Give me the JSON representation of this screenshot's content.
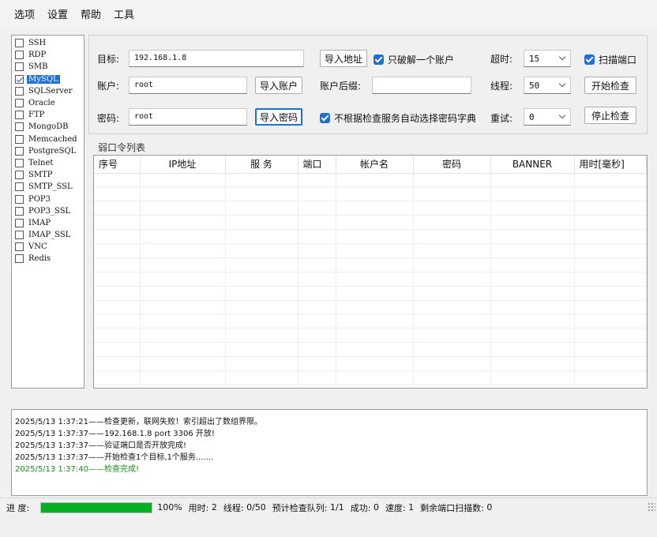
{
  "menu": [
    "选项",
    "设置",
    "帮助",
    "工具"
  ],
  "services": [
    {
      "name": "SSH",
      "checked": false
    },
    {
      "name": "RDP",
      "checked": false
    },
    {
      "name": "SMB",
      "checked": false
    },
    {
      "name": "MySQL",
      "checked": true,
      "selected": true
    },
    {
      "name": "SQLServer",
      "checked": false
    },
    {
      "name": "Oracle",
      "checked": false
    },
    {
      "name": "FTP",
      "checked": false
    },
    {
      "name": "MongoDB",
      "checked": false
    },
    {
      "name": "Memcached",
      "checked": false
    },
    {
      "name": "PostgreSQL",
      "checked": false
    },
    {
      "name": "Telnet",
      "checked": false
    },
    {
      "name": "SMTP",
      "checked": false
    },
    {
      "name": "SMTP_SSL",
      "checked": false
    },
    {
      "name": "POP3",
      "checked": false
    },
    {
      "name": "POP3_SSL",
      "checked": false
    },
    {
      "name": "IMAP",
      "checked": false
    },
    {
      "name": "IMAP_SSL",
      "checked": false
    },
    {
      "name": "VNC",
      "checked": false
    },
    {
      "name": "Redis",
      "checked": false
    }
  ],
  "form": {
    "target_label": "目标:",
    "target_value": "192.168.1.8",
    "import_addr": "导入地址",
    "only_crack_one": "只破解一个账户",
    "timeout_label": "超时:",
    "timeout_value": "15",
    "scan_port": "扫描端口",
    "account_label": "账户:",
    "account_value": "root",
    "import_account": "导入账户",
    "suffix_label": "账户后缀:",
    "suffix_value": "",
    "threads_label": "线程:",
    "threads_value": "50",
    "start_check": "开始检查",
    "password_label": "密码:",
    "password_value": "root",
    "import_password": "导入密码",
    "no_auto_dict": "不根据检查服务自动选择密码字典",
    "retry_label": "重试:",
    "retry_value": "0",
    "stop_check": "停止检查"
  },
  "weak_list": {
    "title": "弱口令列表",
    "columns": [
      "序号",
      "IP地址",
      "服 务",
      "端口",
      "帐户名",
      "密码",
      "BANNER",
      "用时[毫秒]"
    ]
  },
  "log": [
    {
      "text": "2025/5/13 1:37:21——检查更新，联网失败！索引超出了数组界限。",
      "status": "normal"
    },
    {
      "text": "2025/5/13 1:37:37——192.168.1.8 port 3306 开放!",
      "status": "normal"
    },
    {
      "text": "2025/5/13 1:37:37——验证端口是否开放完成!",
      "status": "normal"
    },
    {
      "text": "2025/5/13 1:37:37——开始检查1个目标,1个服务.......",
      "status": "normal"
    },
    {
      "text": "2025/5/13 1:37:40——检查完成!",
      "status": "ok"
    }
  ],
  "status": {
    "progress_label": "进 度:",
    "progress_value": 1.0,
    "progress_text": "100%",
    "elapsed_label": "用时:",
    "elapsed_value": "2",
    "threads_label": "线程:",
    "threads_value": "0/50",
    "queue_label": "预计检查队列:",
    "queue_value": "1/1",
    "success_label": "成功:",
    "success_value": "0",
    "speed_label": "速度:",
    "speed_value": "1",
    "remaining_label": "剩余端口扫描数:",
    "remaining_value": "0"
  },
  "colors": {
    "accent": "#1e6fd9",
    "progress_fill": "#06b025",
    "log_ok": "#1d8a1d"
  }
}
